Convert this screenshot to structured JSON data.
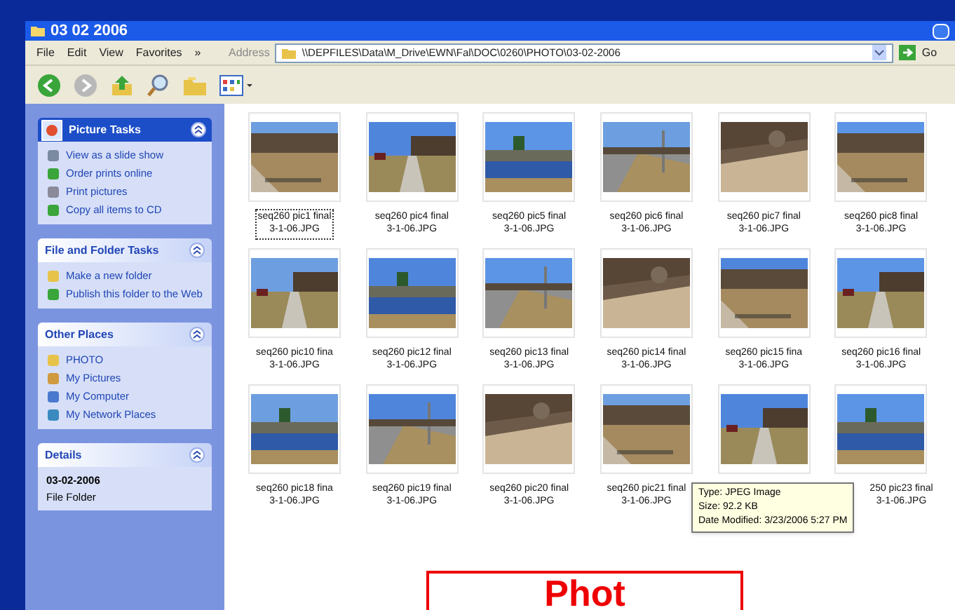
{
  "window": {
    "title": "03 02 2006"
  },
  "menu": [
    "File",
    "Edit",
    "View",
    "Favorites",
    "»"
  ],
  "address": {
    "label": "Address",
    "value": "\\\\DEPFILES\\Data\\M_Drive\\EWN\\Fal\\DOC\\0260\\PHOTO\\03-02-2006",
    "go": "Go"
  },
  "sidebar": [
    {
      "title": "Picture Tasks",
      "kind": "header-icon",
      "items": [
        "View as a slide show",
        "Order prints online",
        "Print pictures",
        "Copy all items to CD"
      ]
    },
    {
      "title": "File and Folder Tasks",
      "kind": "plain",
      "items": [
        "Make a new folder",
        "Publish this folder to the Web"
      ]
    },
    {
      "title": "Other Places",
      "kind": "plain",
      "items": [
        "PHOTO",
        "My Pictures",
        "My Computer",
        "My Network Places"
      ]
    },
    {
      "title": "Details",
      "kind": "details",
      "lines": [
        "03-02-2006",
        "File Folder"
      ]
    }
  ],
  "files": [
    {
      "lines": [
        "seq260 pic1 final",
        "3-1-06.JPG"
      ],
      "focused": true
    },
    {
      "lines": [
        "seq260 pic4 final",
        "3-1-06.JPG"
      ],
      "focused": false
    },
    {
      "lines": [
        "seq260 pic5 final",
        "3-1-06.JPG"
      ],
      "focused": false
    },
    {
      "lines": [
        "seq260 pic6 final",
        "3-1-06.JPG"
      ],
      "focused": false
    },
    {
      "lines": [
        "seq260 pic7 final",
        "3-1-06.JPG"
      ],
      "focused": false
    },
    {
      "lines": [
        "seq260 pic8 final",
        "3-1-06.JPG"
      ],
      "focused": false
    },
    {
      "lines": [
        "seq260 pic10 fina",
        "3-1-06.JPG"
      ],
      "focused": false
    },
    {
      "lines": [
        "seq260 pic12 final",
        "3-1-06.JPG"
      ],
      "focused": false
    },
    {
      "lines": [
        "seq260 pic13 final",
        "3-1-06.JPG"
      ],
      "focused": false
    },
    {
      "lines": [
        "seq260 pic14 final",
        "3-1-06.JPG"
      ],
      "focused": false
    },
    {
      "lines": [
        "seq260 pic15 fina",
        "3-1-06.JPG"
      ],
      "focused": false
    },
    {
      "lines": [
        "seq260 pic16 final",
        "3-1-06.JPG"
      ],
      "focused": false
    },
    {
      "lines": [
        "seq260 pic18 fina",
        "3-1-06.JPG"
      ],
      "focused": false
    },
    {
      "lines": [
        "seq260 pic19 final",
        "3-1-06.JPG"
      ],
      "focused": false
    },
    {
      "lines": [
        "seq260 pic20 final",
        "3-1-06.JPG"
      ],
      "focused": false
    },
    {
      "lines": [
        "seq260 pic21 final",
        "3-1-06.JPG"
      ],
      "focused": false
    },
    {
      "focused": false
    },
    {
      "lines": [
        "250 pic23 final",
        "3-1-06.JPG"
      ],
      "focused": false
    }
  ],
  "tooltip": [
    "Type: JPEG Image",
    "Size: 92.2 KB",
    "Date Modified: 3/23/2006 5:27 PM"
  ],
  "callout": "Phot"
}
